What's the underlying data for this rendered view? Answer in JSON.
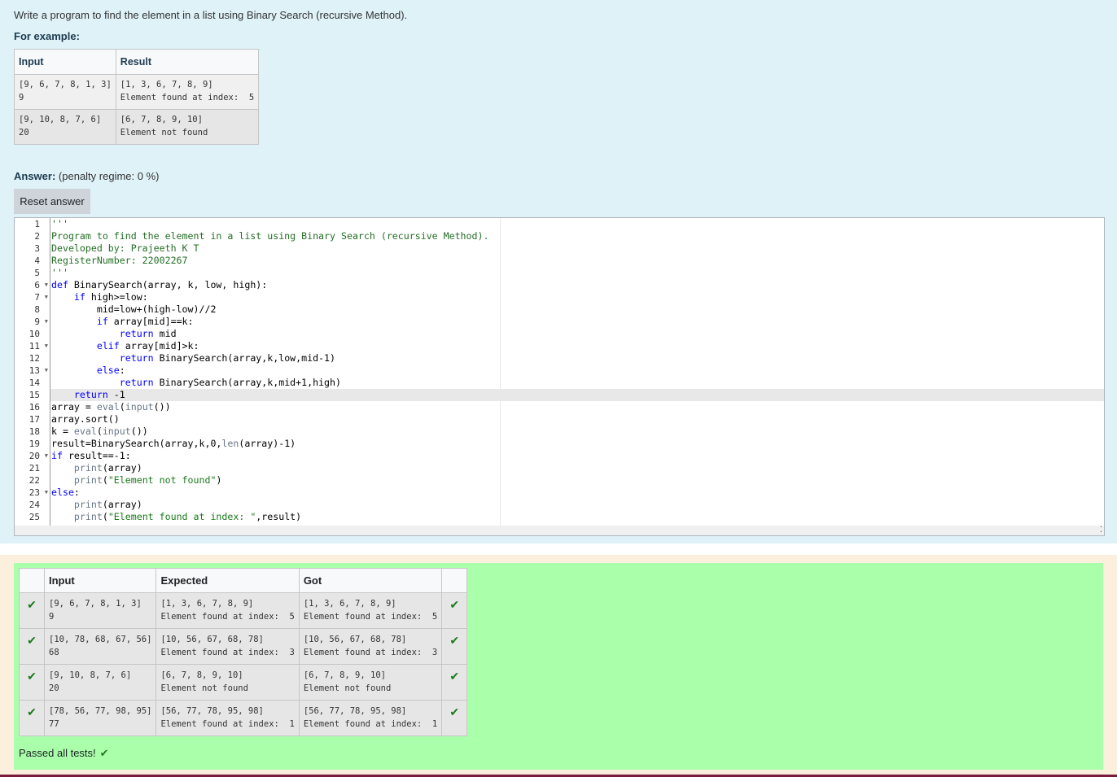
{
  "question": {
    "text": "Write a program to find the element in a list using Binary Search (recursive Method).",
    "example_label": "For example:",
    "example_table": {
      "headers": [
        "Input",
        "Result"
      ],
      "rows": [
        {
          "input": "[9, 6, 7, 8, 1, 3]\n9",
          "result": "[1, 3, 6, 7, 8, 9]\nElement found at index:  5"
        },
        {
          "input": "[9, 10, 8, 7, 6]\n20",
          "result": "[6, 7, 8, 9, 10]\nElement not found"
        }
      ]
    }
  },
  "answer": {
    "label": "Answer:",
    "penalty": "(penalty regime: 0 %)",
    "reset_button": "Reset answer"
  },
  "editor": {
    "active_line": 15,
    "fold_lines": [
      6,
      7,
      9,
      11,
      13,
      20,
      23
    ],
    "lines": [
      "'''",
      "Program to find the element in a list using Binary Search (recursive Method).",
      "Developed by: Prajeeth K T",
      "RegisterNumber: 22002267",
      "'''",
      "def BinarySearch(array, k, low, high):",
      "    if high>=low:",
      "        mid=low+(high-low)//2",
      "        if array[mid]==k:",
      "            return mid",
      "        elif array[mid]>k:",
      "            return BinarySearch(array,k,low,mid-1)",
      "        else:",
      "            return BinarySearch(array,k,mid+1,high)",
      "    return -1",
      "array = eval(input())",
      "array.sort()",
      "k = eval(input())",
      "result=BinarySearch(array,k,0,len(array)-1)",
      "if result==-1:",
      "    print(array)",
      "    print(\"Element not found\")",
      "else:",
      "    print(array)",
      "    print(\"Element found at index: \",result)"
    ]
  },
  "results": {
    "headers": [
      "",
      "Input",
      "Expected",
      "Got",
      ""
    ],
    "rows": [
      {
        "input": "[9, 6, 7, 8, 1, 3]\n9",
        "expected": "[1, 3, 6, 7, 8, 9]\nElement found at index:  5",
        "got": "[1, 3, 6, 7, 8, 9]\nElement found at index:  5"
      },
      {
        "input": "[10, 78, 68, 67, 56]\n68",
        "expected": "[10, 56, 67, 68, 78]\nElement found at index:  3",
        "got": "[10, 56, 67, 68, 78]\nElement found at index:  3"
      },
      {
        "input": "[9, 10, 8, 7, 6]\n20",
        "expected": "[6, 7, 8, 9, 10]\nElement not found",
        "got": "[6, 7, 8, 9, 10]\nElement not found"
      },
      {
        "input": "[78, 56, 77, 98, 95]\n77",
        "expected": "[56, 77, 78, 95, 98]\nElement found at index:  1",
        "got": "[56, 77, 78, 95, 98]\nElement found at index:  1"
      }
    ],
    "status": "Passed all tests!",
    "check_icon": "check-icon",
    "pass_color": "#aaffaa"
  }
}
